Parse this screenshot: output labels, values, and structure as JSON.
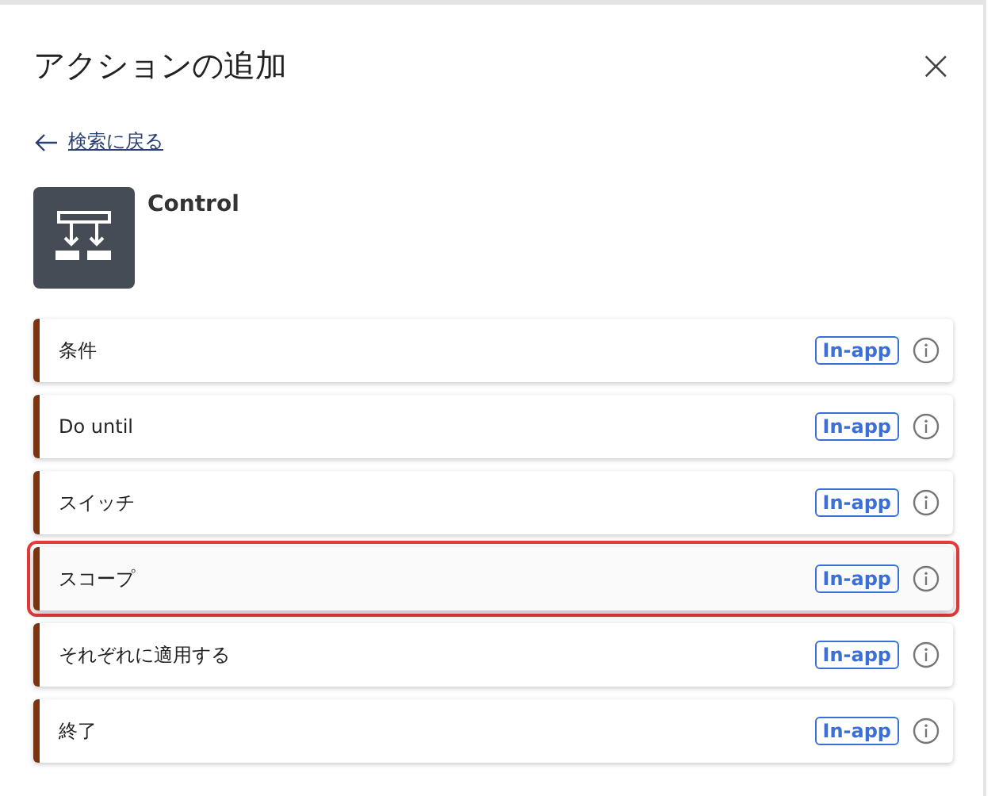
{
  "panel": {
    "title": "アクションの追加",
    "close": "×"
  },
  "back_link": {
    "label": "検索に戻る"
  },
  "connector": {
    "name": "Control"
  },
  "actions": [
    {
      "label": "条件",
      "badge": "In-app",
      "highlighted": false
    },
    {
      "label": "Do until",
      "badge": "In-app",
      "highlighted": false
    },
    {
      "label": "スイッチ",
      "badge": "In-app",
      "highlighted": false
    },
    {
      "label": "スコープ",
      "badge": "In-app",
      "highlighted": true
    },
    {
      "label": "それぞれに適用する",
      "badge": "In-app",
      "highlighted": false
    },
    {
      "label": "終了",
      "badge": "In-app",
      "highlighted": false
    }
  ]
}
